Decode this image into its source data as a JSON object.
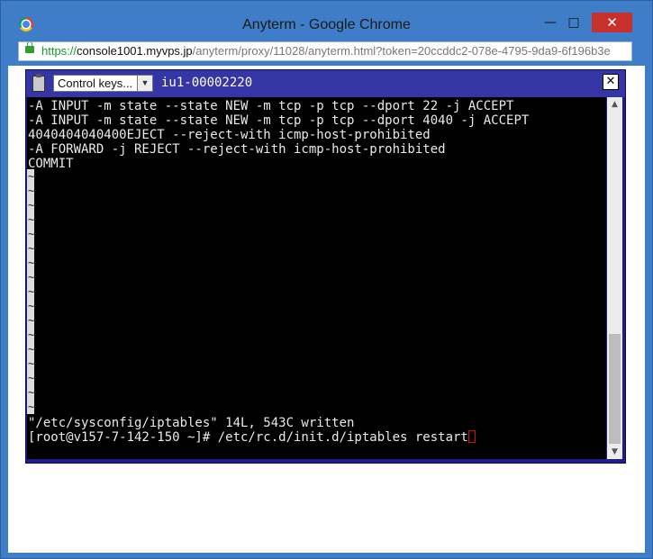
{
  "window": {
    "title": "Anyterm - Google Chrome",
    "minimize_label": "—",
    "maximize_label": "□",
    "close_label": "✕"
  },
  "address": {
    "scheme": "https://",
    "host": "console1001.myvps.jp",
    "path": "/anyterm/proxy/11028/anyterm.html?token=20ccddc2-078e-4795-9da9-6f196b3e"
  },
  "terminal": {
    "control_keys_label": "Control keys...",
    "title": "iu1-00002220",
    "close_label": "✕",
    "lines": [
      "-A INPUT -m state --state NEW -m tcp -p tcp --dport 22 -j ACCEPT",
      "-A INPUT -m state --state NEW -m tcp -p tcp --dport 4040 -j ACCEPT",
      "4040404040400EJECT --reject-with icmp-host-prohibited",
      "-A FORWARD -j REJECT --reject-with icmp-host-prohibited",
      "COMMIT"
    ],
    "tilde": "~",
    "status_line": "\"/etc/sysconfig/iptables\" 14L, 543C written",
    "prompt_line": "[root@v157-7-142-150 ~]# /etc/rc.d/init.d/iptables restart"
  },
  "scrollbar": {
    "position": 1.0
  },
  "colors": {
    "window_frame": "#3f7dc9",
    "close_button": "#c7312b",
    "terminal_frame": "#1e1e8a",
    "terminal_bar": "#3535a5",
    "cursor": "#d01010",
    "https_green": "#1a9a2a"
  },
  "icons": {
    "app": "chrome-icon",
    "secure": "lock-icon",
    "clipboard": "clipboard-icon",
    "dropdown": "chevron-down-icon"
  }
}
